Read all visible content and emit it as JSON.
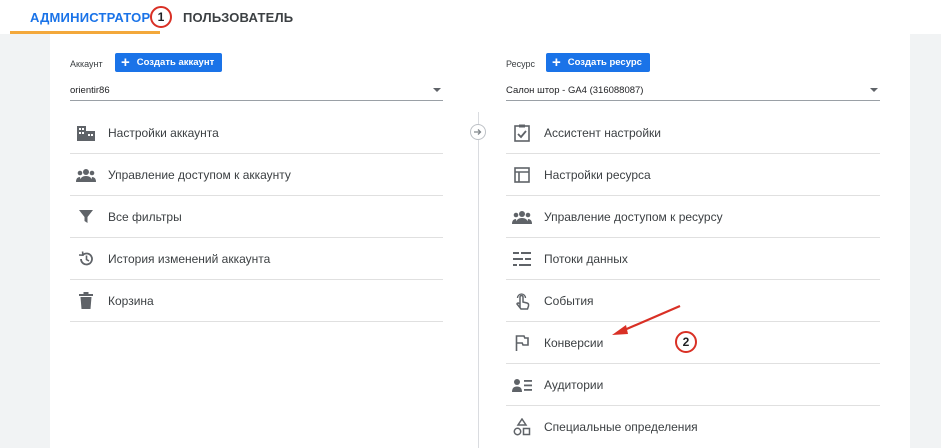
{
  "tabs": {
    "admin": "АДМИНИСТРАТОР",
    "user": "ПОЛЬЗОВАТЕЛЬ"
  },
  "callouts": {
    "first": "1",
    "second": "2"
  },
  "account": {
    "label": "Аккаунт",
    "create_button": "Создать аккаунт",
    "selected": "orientir86",
    "items": [
      {
        "label": "Настройки аккаунта",
        "icon": "building-icon"
      },
      {
        "label": "Управление доступом к аккаунту",
        "icon": "people-icon"
      },
      {
        "label": "Все фильтры",
        "icon": "filter-icon"
      },
      {
        "label": "История изменений аккаунта",
        "icon": "history-icon"
      },
      {
        "label": "Корзина",
        "icon": "trash-icon"
      }
    ]
  },
  "property": {
    "label": "Ресурс",
    "create_button": "Создать ресурс",
    "selected": "Салон штор - GA4 (316088087)",
    "items": [
      {
        "label": "Ассистент настройки",
        "icon": "checklist-icon"
      },
      {
        "label": "Настройки ресурса",
        "icon": "layout-icon"
      },
      {
        "label": "Управление доступом к ресурсу",
        "icon": "people-icon"
      },
      {
        "label": "Потоки данных",
        "icon": "streams-icon"
      },
      {
        "label": "События",
        "icon": "touch-icon"
      },
      {
        "label": "Конверсии",
        "icon": "flag-icon"
      },
      {
        "label": "Аудитории",
        "icon": "audience-icon"
      },
      {
        "label": "Специальные определения",
        "icon": "shapes-icon"
      }
    ]
  },
  "colors": {
    "accent": "#1a73e8",
    "tab_underline": "#f3a83b",
    "annotation": "#d93025"
  }
}
